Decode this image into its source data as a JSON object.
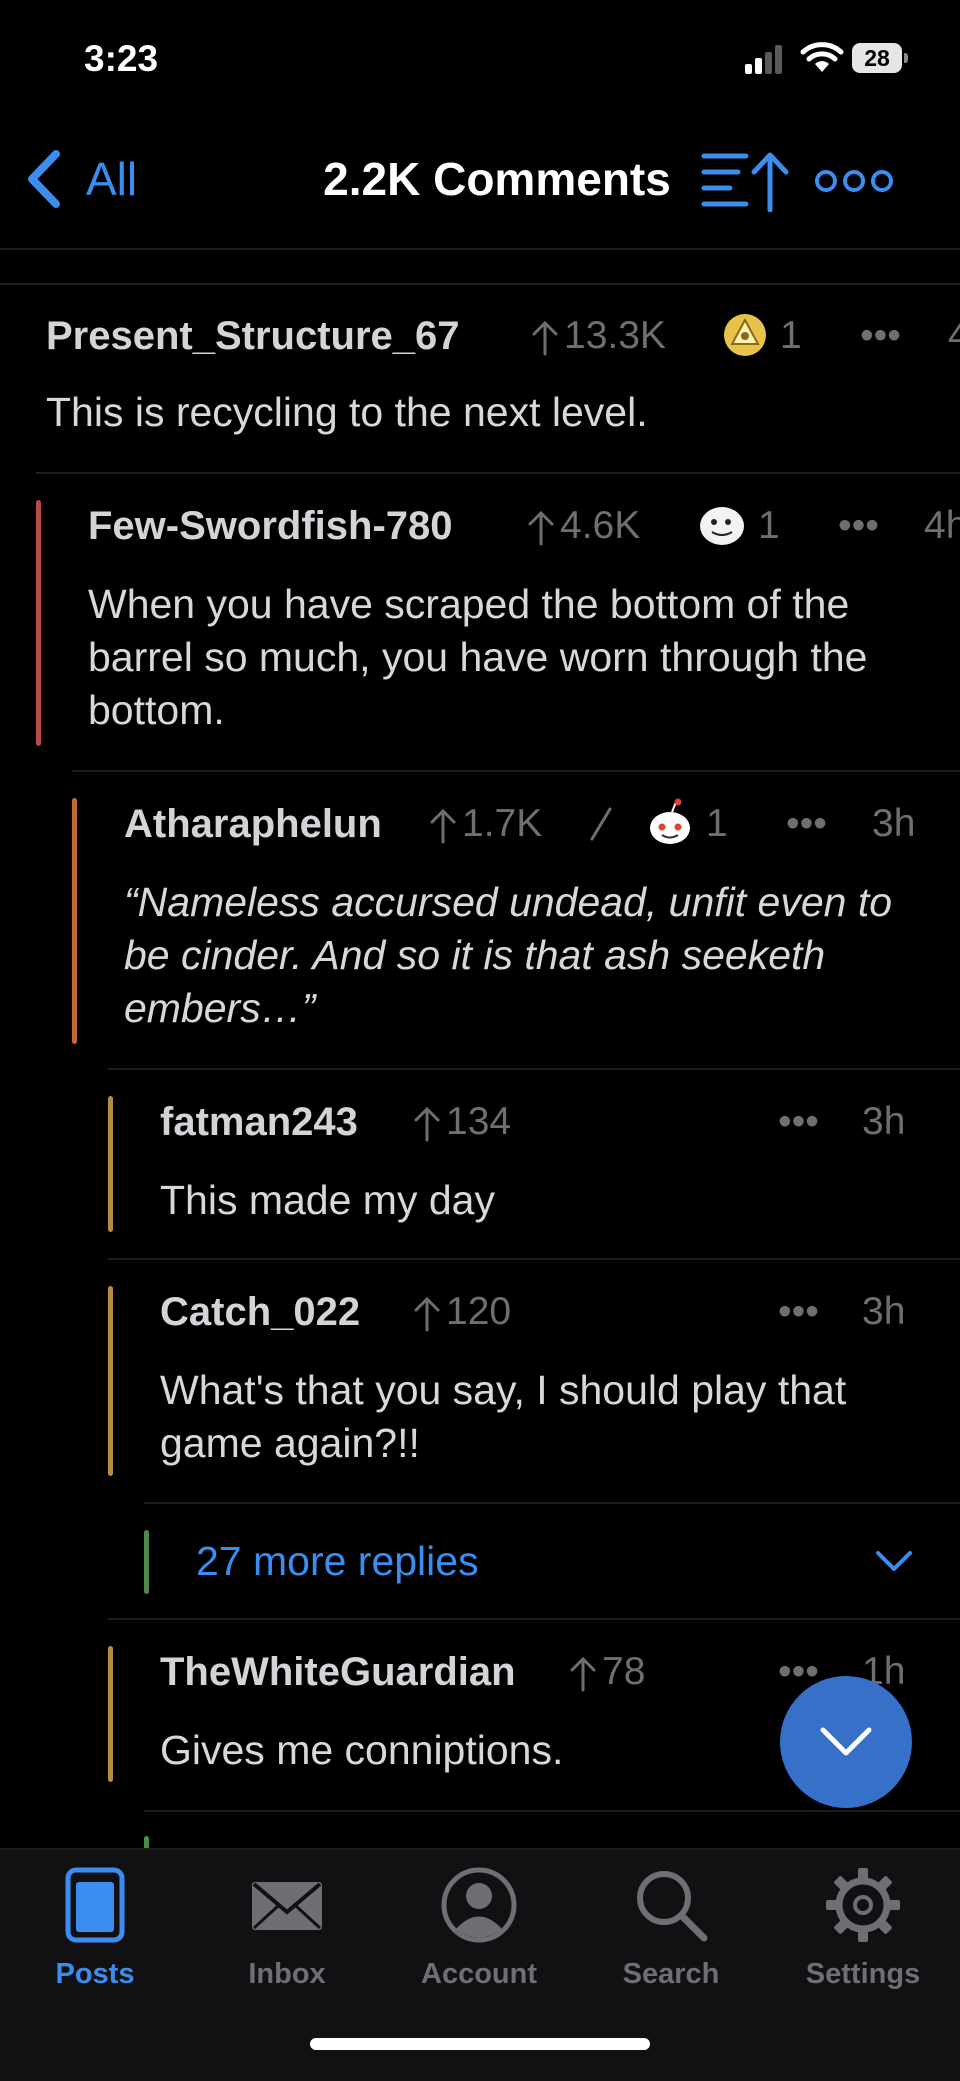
{
  "status": {
    "time": "3:23",
    "battery": "28"
  },
  "nav": {
    "back_label": "All",
    "title": "2.2K Comments"
  },
  "comments": [
    {
      "author": "Present_Structure_67",
      "score": "13.3K",
      "award_count": "1",
      "age": "4",
      "body": "This is recycling to the next level."
    },
    {
      "author": "Few-Swordfish-780",
      "score": "4.6K",
      "award_count": "1",
      "age": "4h",
      "body": "When you have scraped the bottom of the barrel so much, you have worn through the bottom."
    },
    {
      "author": "Atharaphelun",
      "score": "1.7K",
      "award_count": "1",
      "age": "3h",
      "body": "“Nameless accursed undead, unfit even to be cinder. And so it is that ash seeketh embers…”"
    },
    {
      "author": "fatman243",
      "score": "134",
      "age": "3h",
      "body": "This made my day"
    },
    {
      "author": "Catch_022",
      "score": "120",
      "age": "3h",
      "body": "What's that you say, I should play that game again?!!"
    },
    {
      "author": "TheWhiteGuardian",
      "score": "78",
      "age": "1h",
      "body": "Gives me conniptions."
    }
  ],
  "more_replies": {
    "label": "27 more replies"
  },
  "tabs": [
    {
      "label": "Posts",
      "icon": "posts-icon",
      "active": true
    },
    {
      "label": "Inbox",
      "icon": "envelope-icon"
    },
    {
      "label": "Account",
      "icon": "account-icon"
    },
    {
      "label": "Search",
      "icon": "search-icon"
    },
    {
      "label": "Settings",
      "icon": "gear-icon"
    }
  ],
  "colors": {
    "accent": "#3b8df0",
    "thread_level_1": "#b84a4a",
    "thread_level_2": "#c46a34",
    "thread_level_3": "#b58c44",
    "thread_level_4": "#4f8a4a"
  }
}
